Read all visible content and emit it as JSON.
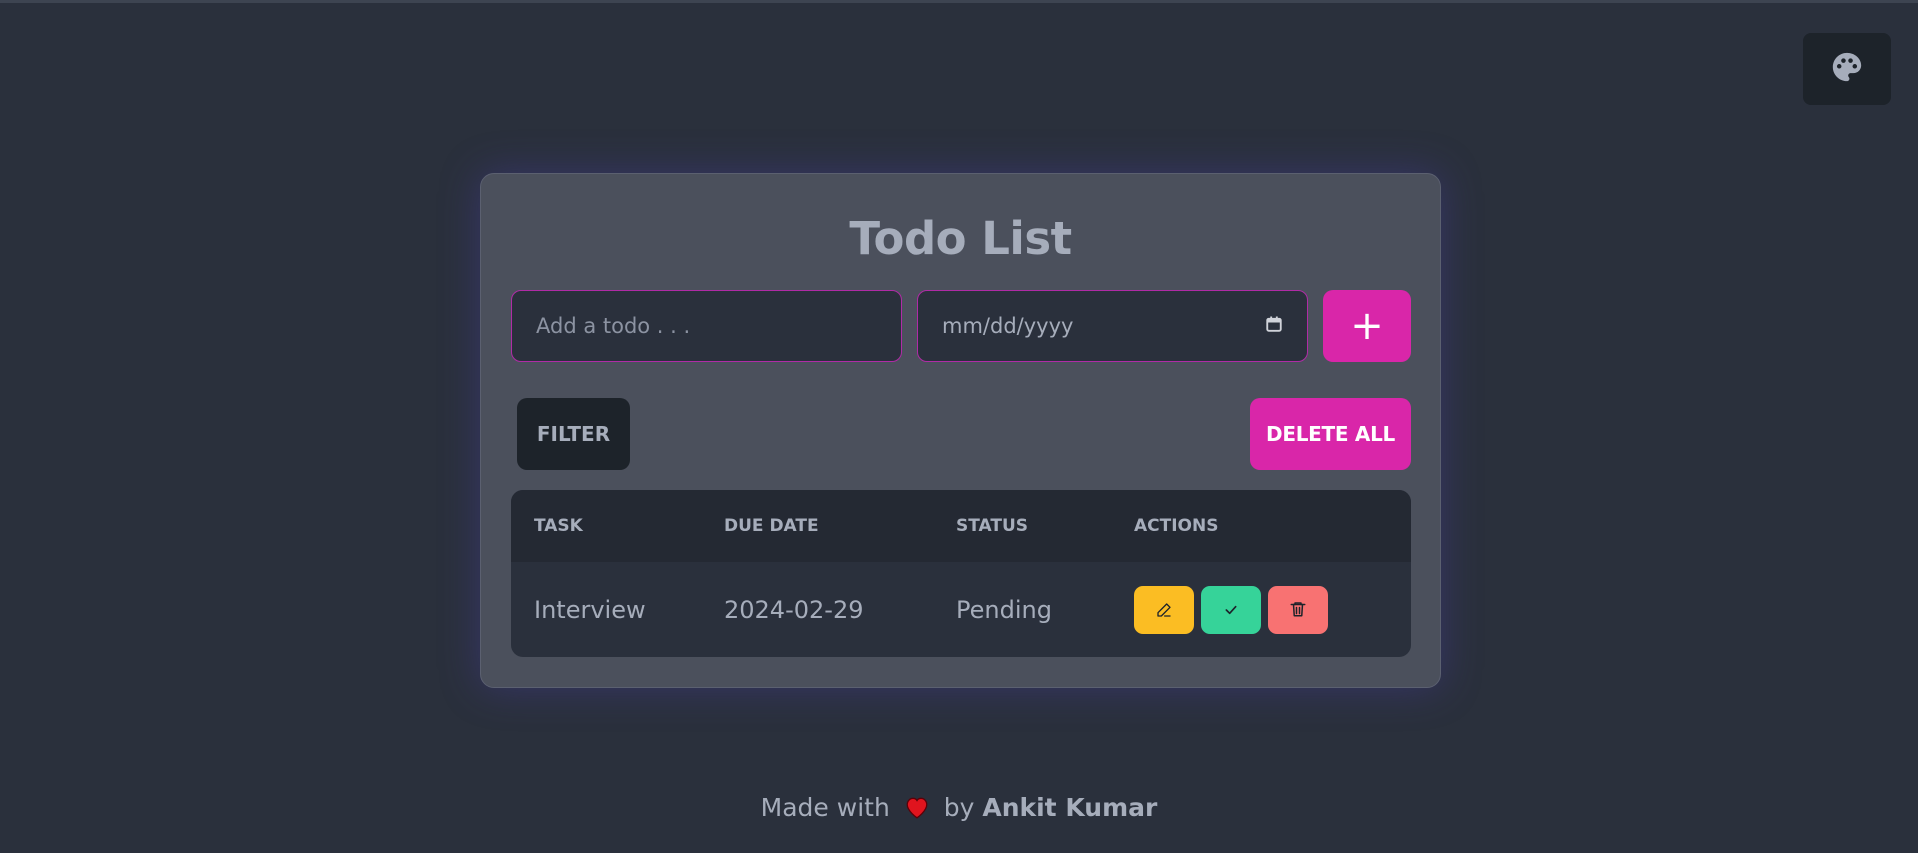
{
  "theme_toggle": {
    "icon": "palette-icon"
  },
  "card": {
    "title": "Todo List",
    "todo_input": {
      "placeholder": "Add a todo . . .",
      "value": ""
    },
    "date_input": {
      "placeholder": "mm/dd/yyyy",
      "value": ""
    },
    "add_label": "+",
    "filter_label": "FILTER",
    "delete_all_label": "DELETE ALL"
  },
  "table": {
    "headers": [
      "TASK",
      "DUE DATE",
      "STATUS",
      "ACTIONS"
    ],
    "rows": [
      {
        "task": "Interview",
        "due_date": "2024-02-29",
        "status": "Pending"
      }
    ]
  },
  "footer": {
    "made_with": "Made with",
    "by": "by",
    "author": "Ankit Kumar"
  },
  "colors": {
    "background": "#2a303c",
    "card": "#4b505c",
    "accent": "#d926a9",
    "edit": "#fbbd23",
    "complete": "#36d399",
    "delete": "#f87272"
  }
}
